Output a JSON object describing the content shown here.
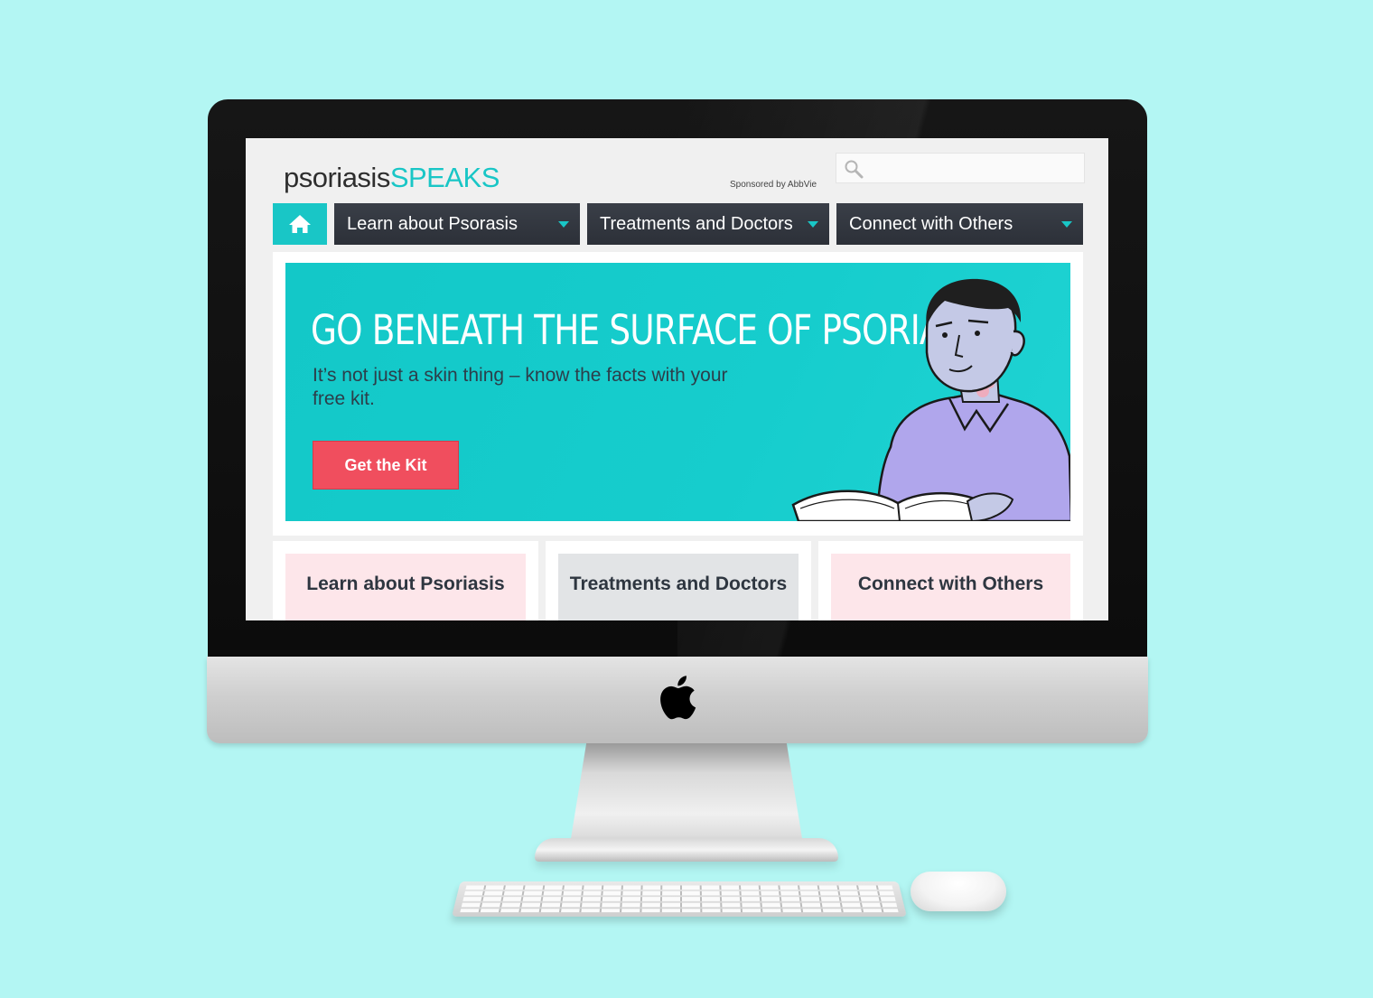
{
  "site": {
    "logo_light": "psoriasis",
    "logo_bold": "SPEAKS",
    "sponsor": "Sponsored by AbbVie",
    "search": {
      "placeholder": "",
      "icon": "search-icon"
    }
  },
  "nav": {
    "home_icon": "home-icon",
    "items": [
      {
        "label": "Learn about Psorasis"
      },
      {
        "label": "Treatments and Doctors"
      },
      {
        "label": "Connect with Others"
      }
    ]
  },
  "hero": {
    "title": "GO BENEATH THE SURFACE OF PSORIASIS",
    "subtitle": "It’s not just a skin thing – know the facts with your free kit.",
    "cta": "Get the Kit"
  },
  "cards": [
    {
      "label": "Learn about Psoriasis"
    },
    {
      "label": "Treatments and Doctors"
    },
    {
      "label": "Connect with Others"
    }
  ],
  "colors": {
    "background": "#b3f6f3",
    "accent": "#19c6c6",
    "nav_dark": "#2c3038",
    "cta": "#f04e5e",
    "card_pink": "#fde6ea",
    "card_gray": "#e2e4e6"
  },
  "hardware": {
    "brand_icon": "apple-logo-icon"
  }
}
